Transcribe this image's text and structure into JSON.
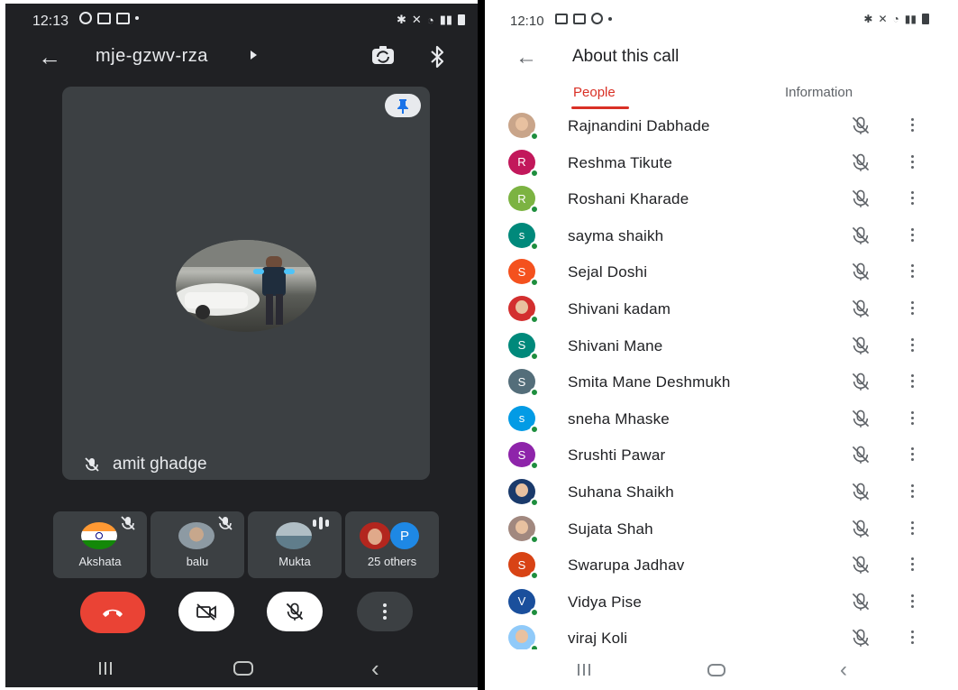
{
  "left": {
    "status_time": "12:13",
    "meeting_code": "mje-gzwv-rza",
    "main_participant": "amit ghadge",
    "thumbnails": [
      {
        "label": "Akshata"
      },
      {
        "label": "balu"
      },
      {
        "label": "Mukta"
      },
      {
        "label": "25 others",
        "avatar_letter": "P"
      }
    ]
  },
  "right": {
    "status_time": "12:10",
    "title": "About this call",
    "tabs": {
      "people": "People",
      "information": "Information"
    },
    "participants": [
      {
        "name": "Rajnandini Dabhade",
        "type": "photo",
        "color": "#c9a58a"
      },
      {
        "name": "Reshma Tikute",
        "letter": "R",
        "color": "#c2185b"
      },
      {
        "name": "Roshani Kharade",
        "letter": "R",
        "color": "#7cb342"
      },
      {
        "name": "sayma shaikh",
        "letter": "s",
        "color": "#00897b"
      },
      {
        "name": "Sejal Doshi",
        "letter": "S",
        "color": "#f4511e"
      },
      {
        "name": "Shivani kadam",
        "type": "photo",
        "color": "#d32f2f"
      },
      {
        "name": "Shivani Mane",
        "letter": "S",
        "color": "#00897b"
      },
      {
        "name": "Smita Mane Deshmukh",
        "letter": "S",
        "color": "#546e7a"
      },
      {
        "name": "sneha Mhaske",
        "letter": "s",
        "color": "#039be5"
      },
      {
        "name": "Srushti Pawar",
        "letter": "S",
        "color": "#8e24aa"
      },
      {
        "name": "Suhana Shaikh",
        "type": "photo",
        "color": "#1a3a6b"
      },
      {
        "name": "Sujata Shah",
        "type": "photo",
        "color": "#a1887f"
      },
      {
        "name": "Swarupa Jadhav",
        "letter": "S",
        "color": "#d84315"
      },
      {
        "name": "Vidya Pise",
        "letter": "V",
        "color": "#1a4f9c"
      },
      {
        "name": "viraj Koli",
        "type": "photo",
        "color": "#90caf9"
      }
    ]
  },
  "colors": {
    "end_call": "#ea4335",
    "accent_red": "#d93025",
    "online": "#1e8e3e",
    "dark_bg": "#202124",
    "tile_bg": "#3c4043"
  },
  "icons": [
    "back-arrow-icon",
    "switch-camera-icon",
    "bluetooth-icon",
    "pin-icon",
    "mic-off-icon",
    "end-call-icon",
    "camera-off-icon",
    "more-vert-icon"
  ]
}
